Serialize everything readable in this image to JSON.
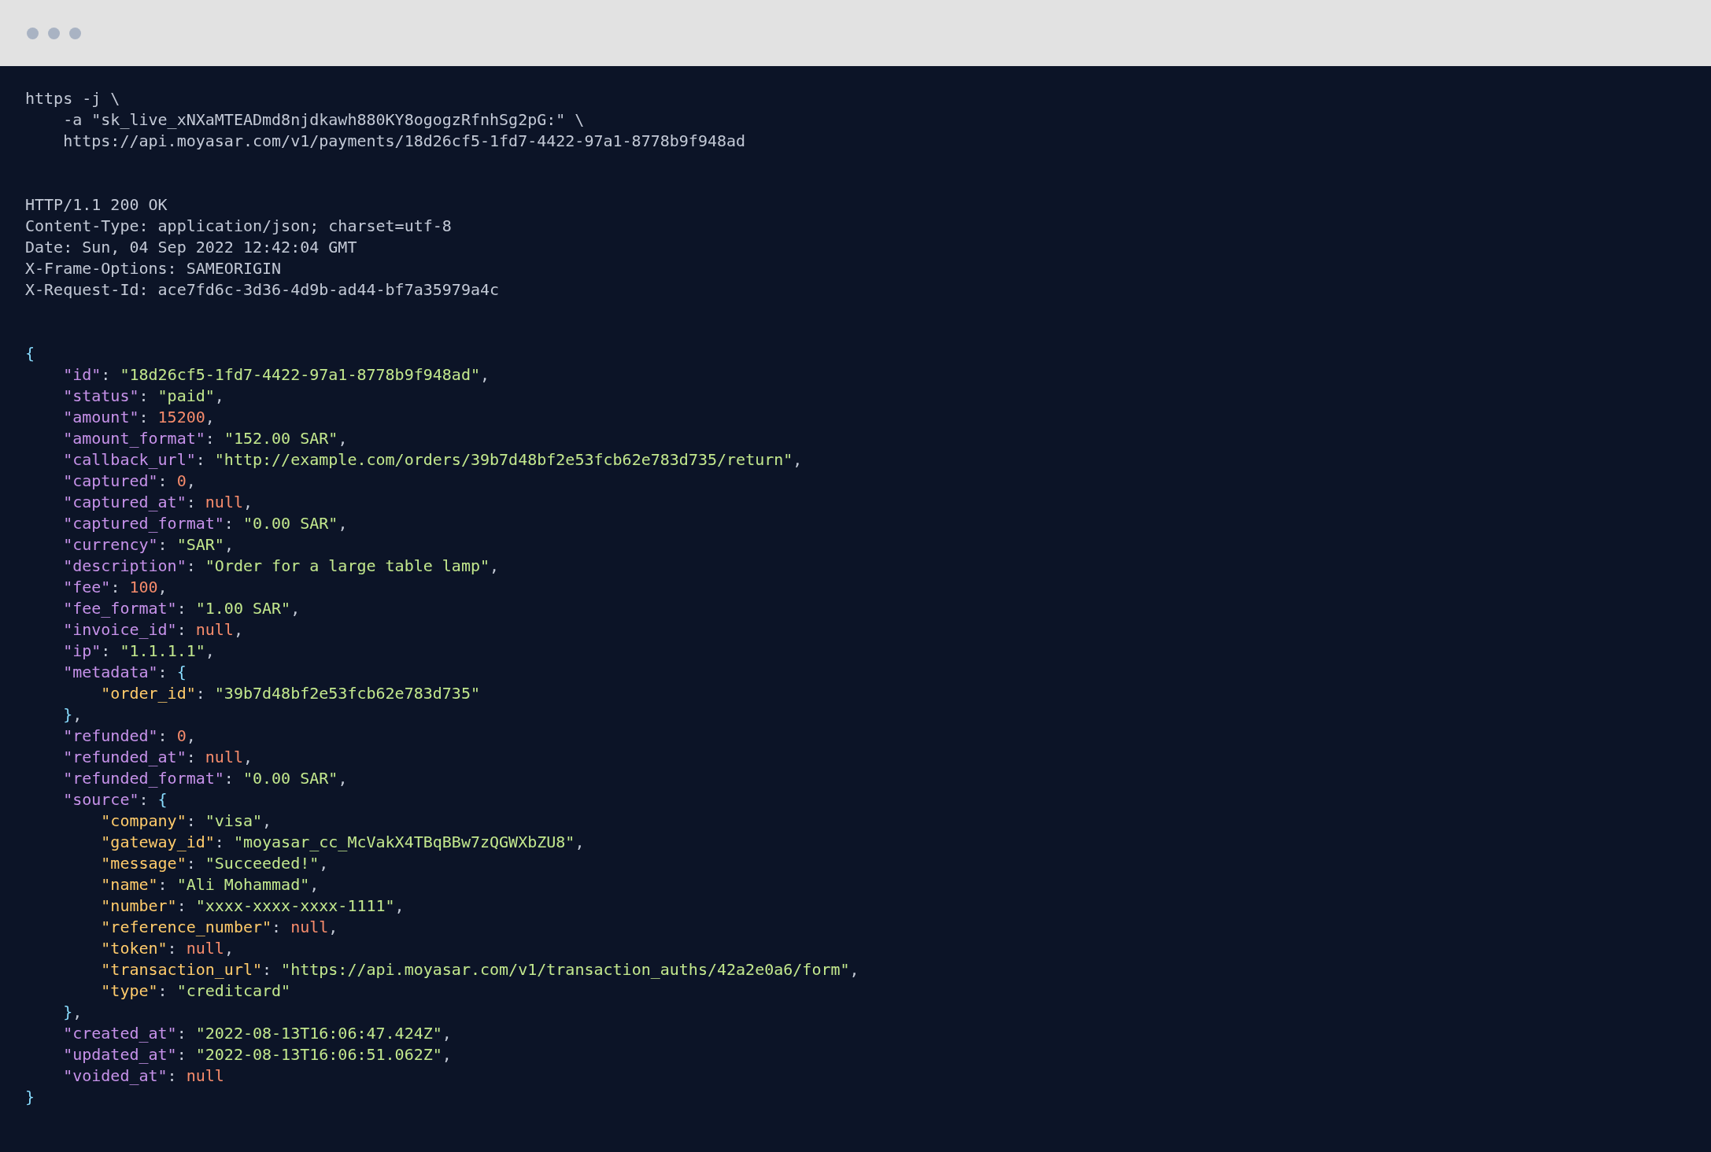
{
  "blocks": [
    {
      "lines": [
        {
          "tokens": [
            {
              "kind": "plain",
              "text": "https -j \\"
            }
          ],
          "children": [
            {
              "tokens": [
                {
                  "kind": "plain",
                  "text": "-a \"sk_live_xNXaMTEADmd8njdkawh880KY8ogogzRfnhSg2pG:\" \\"
                }
              ]
            },
            {
              "tokens": [
                {
                  "kind": "plain",
                  "text": "https://api.moyasar.com/v1/payments/18d26cf5-1fd7-4422-97a1-8778b9f948ad"
                }
              ]
            }
          ]
        }
      ]
    },
    {
      "lines": [
        {
          "tokens": [
            {
              "kind": "plain",
              "text": "HTTP/1.1 200 OK"
            }
          ]
        },
        {
          "tokens": [
            {
              "kind": "plain",
              "text": "Content-Type: application/json; charset=utf-8"
            }
          ]
        },
        {
          "tokens": [
            {
              "kind": "plain",
              "text": "Date: Sun, 04 Sep 2022 12:42:04 GMT"
            }
          ]
        },
        {
          "tokens": [
            {
              "kind": "plain",
              "text": "X-Frame-Options: SAMEORIGIN"
            }
          ]
        },
        {
          "tokens": [
            {
              "kind": "plain",
              "text": "X-Request-Id: ace7fd6c-3d36-4d9b-ad44-bf7a35979a4c"
            }
          ]
        }
      ]
    },
    {
      "lines": [
        {
          "tokens": [
            {
              "kind": "brace",
              "text": "{"
            }
          ],
          "close": [
            {
              "kind": "brace",
              "text": "}"
            }
          ],
          "children": [
            {
              "tokens": [
                {
                  "kind": "key",
                  "text": "\"id\""
                },
                {
                  "kind": "punct",
                  "text": ": "
                },
                {
                  "kind": "string",
                  "text": "\"18d26cf5-1fd7-4422-97a1-8778b9f948ad\""
                },
                {
                  "kind": "punct",
                  "text": ","
                }
              ]
            },
            {
              "tokens": [
                {
                  "kind": "key",
                  "text": "\"status\""
                },
                {
                  "kind": "punct",
                  "text": ": "
                },
                {
                  "kind": "string",
                  "text": "\"paid\""
                },
                {
                  "kind": "punct",
                  "text": ","
                }
              ]
            },
            {
              "tokens": [
                {
                  "kind": "key",
                  "text": "\"amount\""
                },
                {
                  "kind": "punct",
                  "text": ": "
                },
                {
                  "kind": "number",
                  "text": "15200"
                },
                {
                  "kind": "punct",
                  "text": ","
                }
              ]
            },
            {
              "tokens": [
                {
                  "kind": "key",
                  "text": "\"amount_format\""
                },
                {
                  "kind": "punct",
                  "text": ": "
                },
                {
                  "kind": "string",
                  "text": "\"152.00 SAR\""
                },
                {
                  "kind": "punct",
                  "text": ","
                }
              ]
            },
            {
              "tokens": [
                {
                  "kind": "key",
                  "text": "\"callback_url\""
                },
                {
                  "kind": "punct",
                  "text": ": "
                },
                {
                  "kind": "string",
                  "text": "\"http://example.com/orders/39b7d48bf2e53fcb62e783d735/return\""
                },
                {
                  "kind": "punct",
                  "text": ","
                }
              ]
            },
            {
              "tokens": [
                {
                  "kind": "key",
                  "text": "\"captured\""
                },
                {
                  "kind": "punct",
                  "text": ": "
                },
                {
                  "kind": "number",
                  "text": "0"
                },
                {
                  "kind": "punct",
                  "text": ","
                }
              ]
            },
            {
              "tokens": [
                {
                  "kind": "key",
                  "text": "\"captured_at\""
                },
                {
                  "kind": "punct",
                  "text": ": "
                },
                {
                  "kind": "null",
                  "text": "null"
                },
                {
                  "kind": "punct",
                  "text": ","
                }
              ]
            },
            {
              "tokens": [
                {
                  "kind": "key",
                  "text": "\"captured_format\""
                },
                {
                  "kind": "punct",
                  "text": ": "
                },
                {
                  "kind": "string",
                  "text": "\"0.00 SAR\""
                },
                {
                  "kind": "punct",
                  "text": ","
                }
              ]
            },
            {
              "tokens": [
                {
                  "kind": "key",
                  "text": "\"currency\""
                },
                {
                  "kind": "punct",
                  "text": ": "
                },
                {
                  "kind": "string",
                  "text": "\"SAR\""
                },
                {
                  "kind": "punct",
                  "text": ","
                }
              ]
            },
            {
              "tokens": [
                {
                  "kind": "key",
                  "text": "\"description\""
                },
                {
                  "kind": "punct",
                  "text": ": "
                },
                {
                  "kind": "string",
                  "text": "\"Order for a large table lamp\""
                },
                {
                  "kind": "punct",
                  "text": ","
                }
              ]
            },
            {
              "tokens": [
                {
                  "kind": "key",
                  "text": "\"fee\""
                },
                {
                  "kind": "punct",
                  "text": ": "
                },
                {
                  "kind": "number",
                  "text": "100"
                },
                {
                  "kind": "punct",
                  "text": ","
                }
              ]
            },
            {
              "tokens": [
                {
                  "kind": "key",
                  "text": "\"fee_format\""
                },
                {
                  "kind": "punct",
                  "text": ": "
                },
                {
                  "kind": "string",
                  "text": "\"1.00 SAR\""
                },
                {
                  "kind": "punct",
                  "text": ","
                }
              ]
            },
            {
              "tokens": [
                {
                  "kind": "key",
                  "text": "\"invoice_id\""
                },
                {
                  "kind": "punct",
                  "text": ": "
                },
                {
                  "kind": "null",
                  "text": "null"
                },
                {
                  "kind": "punct",
                  "text": ","
                }
              ]
            },
            {
              "tokens": [
                {
                  "kind": "key",
                  "text": "\"ip\""
                },
                {
                  "kind": "punct",
                  "text": ": "
                },
                {
                  "kind": "string",
                  "text": "\"1.1.1.1\""
                },
                {
                  "kind": "punct",
                  "text": ","
                }
              ]
            },
            {
              "tokens": [
                {
                  "kind": "key",
                  "text": "\"metadata\""
                },
                {
                  "kind": "punct",
                  "text": ": "
                },
                {
                  "kind": "brace",
                  "text": "{"
                }
              ],
              "close": [
                {
                  "kind": "brace",
                  "text": "}"
                },
                {
                  "kind": "punct",
                  "text": ","
                }
              ],
              "children": [
                {
                  "tokens": [
                    {
                      "kind": "key",
                      "text": "\"order_id\""
                    },
                    {
                      "kind": "punct",
                      "text": ": "
                    },
                    {
                      "kind": "string",
                      "text": "\"39b7d48bf2e53fcb62e783d735\""
                    }
                  ]
                }
              ]
            },
            {
              "tokens": [
                {
                  "kind": "key",
                  "text": "\"refunded\""
                },
                {
                  "kind": "punct",
                  "text": ": "
                },
                {
                  "kind": "number",
                  "text": "0"
                },
                {
                  "kind": "punct",
                  "text": ","
                }
              ]
            },
            {
              "tokens": [
                {
                  "kind": "key",
                  "text": "\"refunded_at\""
                },
                {
                  "kind": "punct",
                  "text": ": "
                },
                {
                  "kind": "null",
                  "text": "null"
                },
                {
                  "kind": "punct",
                  "text": ","
                }
              ]
            },
            {
              "tokens": [
                {
                  "kind": "key",
                  "text": "\"refunded_format\""
                },
                {
                  "kind": "punct",
                  "text": ": "
                },
                {
                  "kind": "string",
                  "text": "\"0.00 SAR\""
                },
                {
                  "kind": "punct",
                  "text": ","
                }
              ]
            },
            {
              "tokens": [
                {
                  "kind": "key",
                  "text": "\"source\""
                },
                {
                  "kind": "punct",
                  "text": ": "
                },
                {
                  "kind": "brace",
                  "text": "{"
                }
              ],
              "close": [
                {
                  "kind": "brace",
                  "text": "}"
                },
                {
                  "kind": "punct",
                  "text": ","
                }
              ],
              "children": [
                {
                  "tokens": [
                    {
                      "kind": "key",
                      "text": "\"company\""
                    },
                    {
                      "kind": "punct",
                      "text": ": "
                    },
                    {
                      "kind": "string",
                      "text": "\"visa\""
                    },
                    {
                      "kind": "punct",
                      "text": ","
                    }
                  ]
                },
                {
                  "tokens": [
                    {
                      "kind": "key",
                      "text": "\"gateway_id\""
                    },
                    {
                      "kind": "punct",
                      "text": ": "
                    },
                    {
                      "kind": "string",
                      "text": "\"moyasar_cc_McVakX4TBqBBw7zQGWXbZU8\""
                    },
                    {
                      "kind": "punct",
                      "text": ","
                    }
                  ]
                },
                {
                  "tokens": [
                    {
                      "kind": "key",
                      "text": "\"message\""
                    },
                    {
                      "kind": "punct",
                      "text": ": "
                    },
                    {
                      "kind": "string",
                      "text": "\"Succeeded!\""
                    },
                    {
                      "kind": "punct",
                      "text": ","
                    }
                  ]
                },
                {
                  "tokens": [
                    {
                      "kind": "key",
                      "text": "\"name\""
                    },
                    {
                      "kind": "punct",
                      "text": ": "
                    },
                    {
                      "kind": "string",
                      "text": "\"Ali Mohammad\""
                    },
                    {
                      "kind": "punct",
                      "text": ","
                    }
                  ]
                },
                {
                  "tokens": [
                    {
                      "kind": "key",
                      "text": "\"number\""
                    },
                    {
                      "kind": "punct",
                      "text": ": "
                    },
                    {
                      "kind": "string",
                      "text": "\"xxxx-xxxx-xxxx-1111\""
                    },
                    {
                      "kind": "punct",
                      "text": ","
                    }
                  ]
                },
                {
                  "tokens": [
                    {
                      "kind": "key",
                      "text": "\"reference_number\""
                    },
                    {
                      "kind": "punct",
                      "text": ": "
                    },
                    {
                      "kind": "null",
                      "text": "null"
                    },
                    {
                      "kind": "punct",
                      "text": ","
                    }
                  ]
                },
                {
                  "tokens": [
                    {
                      "kind": "key",
                      "text": "\"token\""
                    },
                    {
                      "kind": "punct",
                      "text": ": "
                    },
                    {
                      "kind": "null",
                      "text": "null"
                    },
                    {
                      "kind": "punct",
                      "text": ","
                    }
                  ]
                },
                {
                  "tokens": [
                    {
                      "kind": "key",
                      "text": "\"transaction_url\""
                    },
                    {
                      "kind": "punct",
                      "text": ": "
                    },
                    {
                      "kind": "string",
                      "text": "\"https://api.moyasar.com/v1/transaction_auths/42a2e0a6/form\""
                    },
                    {
                      "kind": "punct",
                      "text": ","
                    }
                  ]
                },
                {
                  "tokens": [
                    {
                      "kind": "key",
                      "text": "\"type\""
                    },
                    {
                      "kind": "punct",
                      "text": ": "
                    },
                    {
                      "kind": "string",
                      "text": "\"creditcard\""
                    }
                  ]
                }
              ]
            },
            {
              "tokens": [
                {
                  "kind": "key",
                  "text": "\"created_at\""
                },
                {
                  "kind": "punct",
                  "text": ": "
                },
                {
                  "kind": "string",
                  "text": "\"2022-08-13T16:06:47.424Z\""
                },
                {
                  "kind": "punct",
                  "text": ","
                }
              ]
            },
            {
              "tokens": [
                {
                  "kind": "key",
                  "text": "\"updated_at\""
                },
                {
                  "kind": "punct",
                  "text": ": "
                },
                {
                  "kind": "string",
                  "text": "\"2022-08-13T16:06:51.062Z\""
                },
                {
                  "kind": "punct",
                  "text": ","
                }
              ]
            },
            {
              "tokens": [
                {
                  "kind": "key",
                  "text": "\"voided_at\""
                },
                {
                  "kind": "punct",
                  "text": ": "
                },
                {
                  "kind": "null",
                  "text": "null"
                }
              ]
            }
          ]
        }
      ]
    }
  ]
}
